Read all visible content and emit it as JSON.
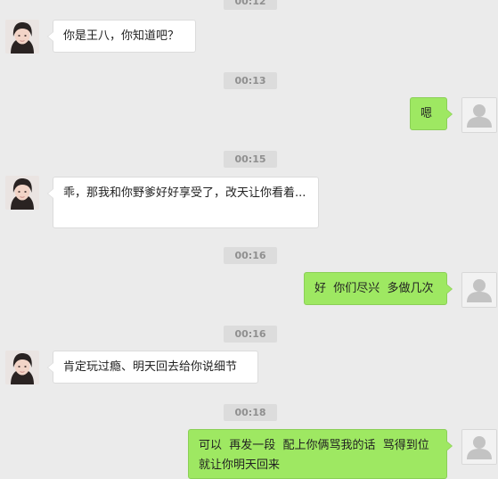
{
  "messages": [
    {
      "side": "time",
      "text": "00:12"
    },
    {
      "side": "in",
      "text": "你是王八，你知道吧？"
    },
    {
      "side": "time",
      "text": "00:13"
    },
    {
      "side": "out",
      "text": "嗯"
    },
    {
      "side": "time",
      "text": "00:15"
    },
    {
      "side": "in",
      "text": "乖，那我和你野爹好好享受了，改天让你看着..."
    },
    {
      "side": "time",
      "text": "00:16"
    },
    {
      "side": "out",
      "text": "好  你们尽兴  多做几次"
    },
    {
      "side": "time",
      "text": "00:16"
    },
    {
      "side": "in",
      "text": "肯定玩过瘾、明天回去给你说细节"
    },
    {
      "side": "time",
      "text": "00:18"
    },
    {
      "side": "out",
      "text": "可以  再发一段  配上你俩骂我的话  骂得到位就让你明天回来"
    }
  ],
  "colors": {
    "background": "#ebebeb",
    "incoming_bubble": "#ffffff",
    "outgoing_bubble": "#9ee862",
    "timestamp_bg": "#dcdcdc"
  },
  "icons": {
    "self_avatar": "default-user-silhouette-icon",
    "contact_avatar": "contact-photo-avatar"
  }
}
